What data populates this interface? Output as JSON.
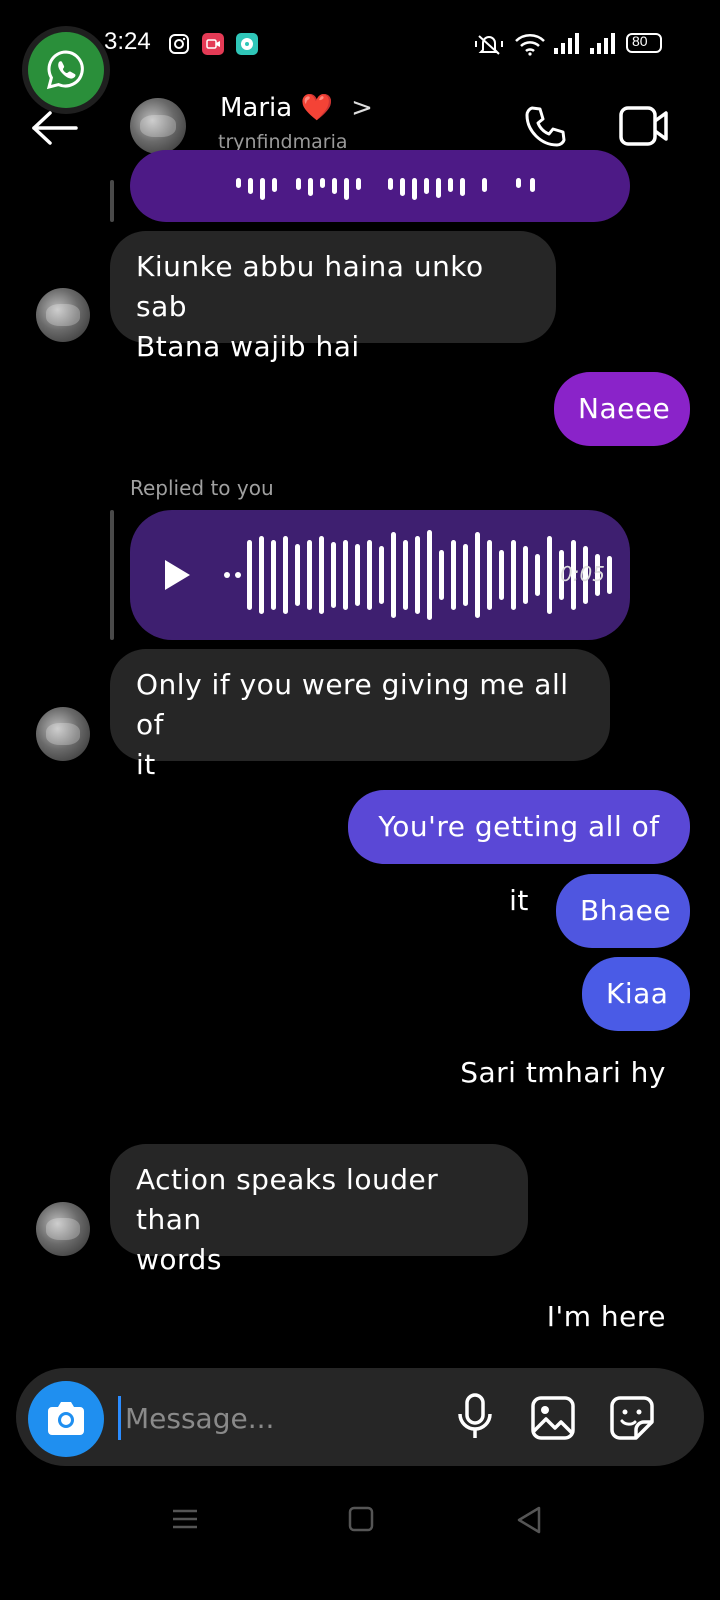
{
  "status_bar": {
    "time": "3:24",
    "battery": "80",
    "icons": [
      "instagram-icon",
      "screen-record-icon",
      "chat-app-icon",
      "silent-icon",
      "wifi-icon",
      "signal-icon",
      "signal-icon",
      "battery-icon"
    ]
  },
  "header": {
    "contact_name": "Maria",
    "contact_emoji": "❤️",
    "chevron": ">",
    "contact_handle": "trynfindmaria",
    "icons": [
      "back-arrow-icon",
      "phone-icon",
      "video-camera-icon"
    ]
  },
  "messages": [
    {
      "id": "m1",
      "side": "in",
      "type": "text",
      "lines": [
        "Kiunke abbu haina unko sab",
        "Btana wajib hai"
      ]
    },
    {
      "id": "m2",
      "side": "out",
      "type": "text",
      "text": "Naeee",
      "color": "#8a23c9"
    },
    {
      "id": "m3",
      "side": "in",
      "type": "voice",
      "reply_label": "Replied to you",
      "duration": "0:05"
    },
    {
      "id": "m4",
      "side": "in",
      "type": "text",
      "lines": [
        "Only if you were giving me all of",
        "it"
      ]
    },
    {
      "id": "m5",
      "side": "out",
      "type": "text",
      "text": "You're getting all of it",
      "color": "#5a48d6"
    },
    {
      "id": "m6",
      "side": "out",
      "type": "text",
      "text": "Bhaee",
      "color": "#4f56e0"
    },
    {
      "id": "m7",
      "side": "out",
      "type": "text",
      "text": "Kiaa",
      "color": "#4a5be6"
    },
    {
      "id": "m8",
      "side": "out",
      "type": "plain",
      "text": "Sari tmhari hy"
    },
    {
      "id": "m9",
      "side": "in",
      "type": "text",
      "lines": [
        "Action speaks louder than",
        "words"
      ]
    },
    {
      "id": "m10",
      "side": "out",
      "type": "plain",
      "text": "I'm here"
    }
  ],
  "composer": {
    "placeholder": "Message...",
    "icons": [
      "camera-icon",
      "microphone-icon",
      "gallery-icon",
      "sticker-icon"
    ]
  },
  "colors": {
    "background": "#000000",
    "incoming_bubble": "#262626",
    "voice_bubble": "#3e1f70",
    "camera_button": "#1f8ff0"
  }
}
